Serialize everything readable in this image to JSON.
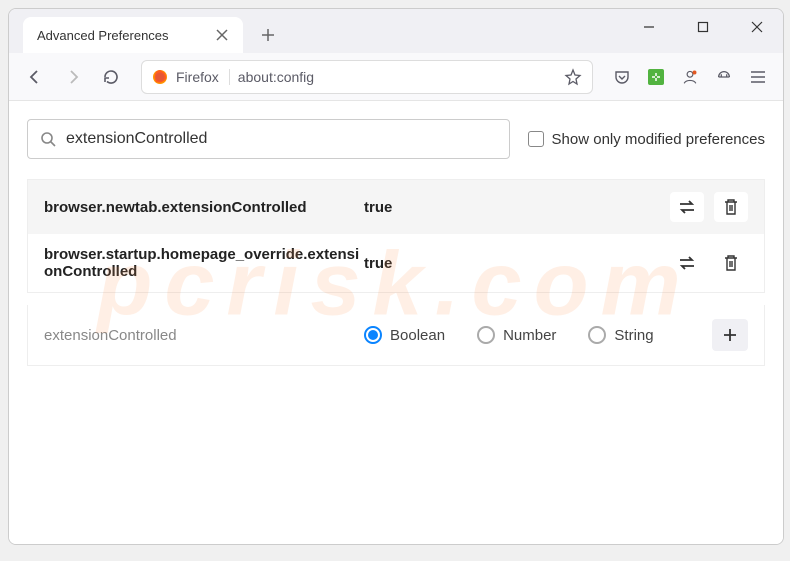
{
  "window": {
    "tab_title": "Advanced Preferences"
  },
  "toolbar": {
    "context_label": "Firefox",
    "url": "about:config"
  },
  "search": {
    "value": "extensionControlled",
    "modified_label": "Show only modified preferences"
  },
  "prefs": [
    {
      "name": "browser.newtab.extensionControlled",
      "value": "true"
    },
    {
      "name": "browser.startup.homepage_override.extensionControlled",
      "value": "true"
    }
  ],
  "new_pref": {
    "name": "extensionControlled",
    "types": [
      "Boolean",
      "Number",
      "String"
    ],
    "selected": "Boolean"
  },
  "watermark": "pcrisk.com"
}
